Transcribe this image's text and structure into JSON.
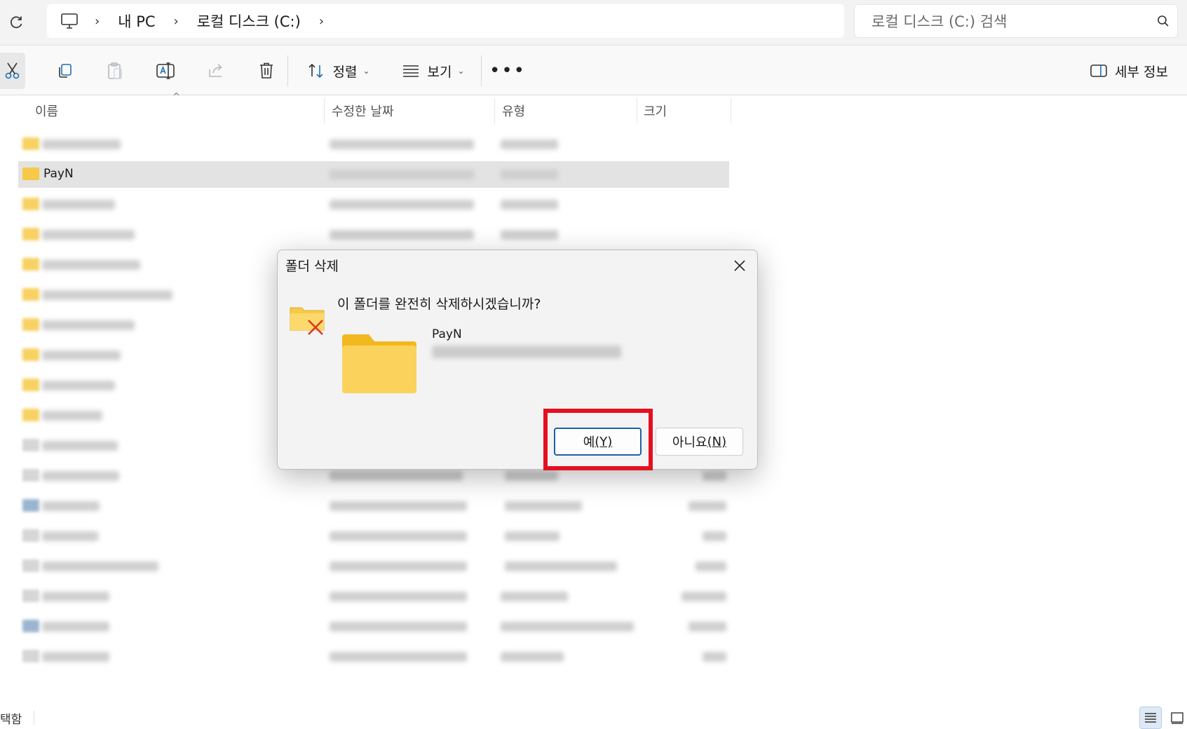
{
  "address_bar": {
    "breadcrumbs": [
      "내 PC",
      "로컬 디스크 (C:)"
    ],
    "search_placeholder": "로컬 디스크 (C:) 검색"
  },
  "toolbar": {
    "sort_label": "정렬",
    "view_label": "보기",
    "more_label": "•••",
    "details_label": "세부 정보"
  },
  "columns": {
    "name": "이름",
    "modified": "수정한 날짜",
    "type": "유형",
    "size": "크기"
  },
  "files": {
    "selected_name": "PayN"
  },
  "status_bar": {
    "text": "택함"
  },
  "dialog": {
    "title": "폴더 삭제",
    "question": "이 폴더를 완전히 삭제하시겠습니까?",
    "folder_name": "PayN",
    "yes_label": "예",
    "yes_key": "(Y)",
    "no_label": "아니요",
    "no_key": "(N)"
  },
  "colors": {
    "highlight_box": "#e5101f",
    "folder_yellow": "#f7c948",
    "default_button_border": "#1d5fa8"
  }
}
